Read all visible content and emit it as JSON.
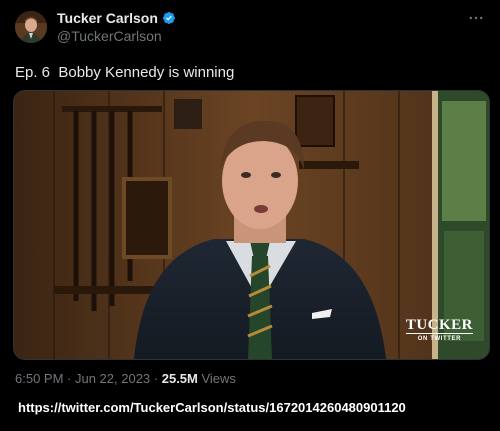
{
  "author": {
    "display_name": "Tucker Carlson",
    "handle": "@TuckerCarlson",
    "verified": true
  },
  "tweet": {
    "text": "Ep. 6  Bobby Kennedy is winning"
  },
  "media": {
    "type": "video",
    "watermark_main": "TUCKER",
    "watermark_sub": "ON TWITTER"
  },
  "meta": {
    "time": "6:50 PM",
    "separator_1": " · ",
    "date": "Jun 22, 2023",
    "separator_2": " · ",
    "views_count": "25.5M",
    "views_label": " Views"
  },
  "status_url": "https://twitter.com/TuckerCarlson/status/1672014260480901120",
  "colors": {
    "background": "#000000",
    "text_primary": "#e7e9ea",
    "text_secondary": "#71767b",
    "verified_badge": "#1d9bf0"
  },
  "icons": {
    "verified": "verified-badge-icon",
    "more": "more-options-icon"
  }
}
